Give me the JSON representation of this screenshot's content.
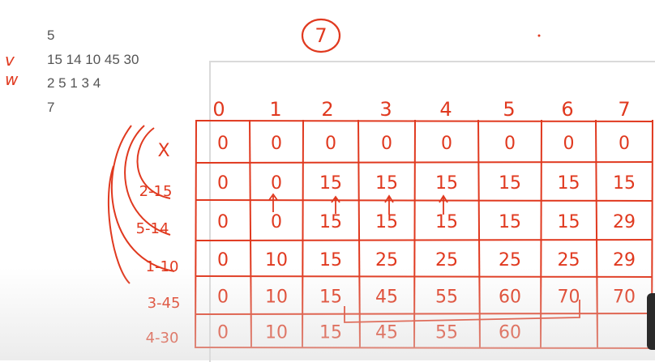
{
  "input": {
    "n": "5",
    "values": "15 14 10 45 30",
    "weights": "2 5 1 3 4",
    "capacity": "7",
    "values_mark": "v",
    "weights_mark": "w"
  },
  "capacity_circled": "7",
  "dp_table": {
    "col_headers": [
      "0",
      "1",
      "2",
      "3",
      "4",
      "5",
      "6",
      "7"
    ],
    "row_labels": [
      "X",
      "2-15",
      "5-14",
      "1-10",
      "3-45",
      "4-30"
    ],
    "rows": [
      [
        "0",
        "0",
        "0",
        "0",
        "0",
        "0",
        "0",
        "0"
      ],
      [
        "0",
        "0",
        "15",
        "15",
        "15",
        "15",
        "15",
        "15"
      ],
      [
        "0",
        "0",
        "15",
        "15",
        "15",
        "15",
        "15",
        "29"
      ],
      [
        "0",
        "10",
        "15",
        "25",
        "25",
        "25",
        "25",
        "29"
      ],
      [
        "0",
        "10",
        "15",
        "45",
        "55",
        "60",
        "70",
        "70"
      ],
      [
        "0",
        "10",
        "15",
        "45",
        "55",
        "60",
        "",
        ""
      ]
    ],
    "ink_color": "#e0391f"
  }
}
